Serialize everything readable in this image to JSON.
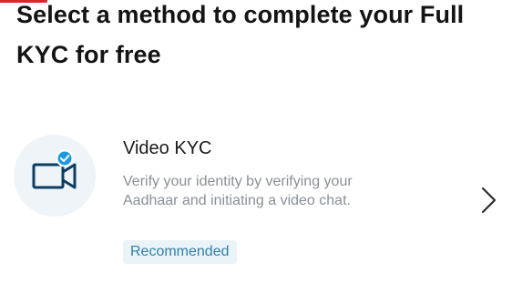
{
  "header": {
    "title": "Select a method to complete your Full KYC for free"
  },
  "methods": [
    {
      "icon": "video-camera-verified-icon",
      "title": "Video KYC",
      "description": "Verify your identity by verifying your Aadhaar and initiating a video chat.",
      "badge": "Recommended"
    }
  ],
  "colors": {
    "accent": "#d9262c",
    "icon_stroke": "#0d3d63",
    "verified_badge": "#1e9be0",
    "badge_text": "#2e7fb0",
    "badge_bg": "#eaf3f8",
    "icon_bg": "#eef4f8"
  }
}
